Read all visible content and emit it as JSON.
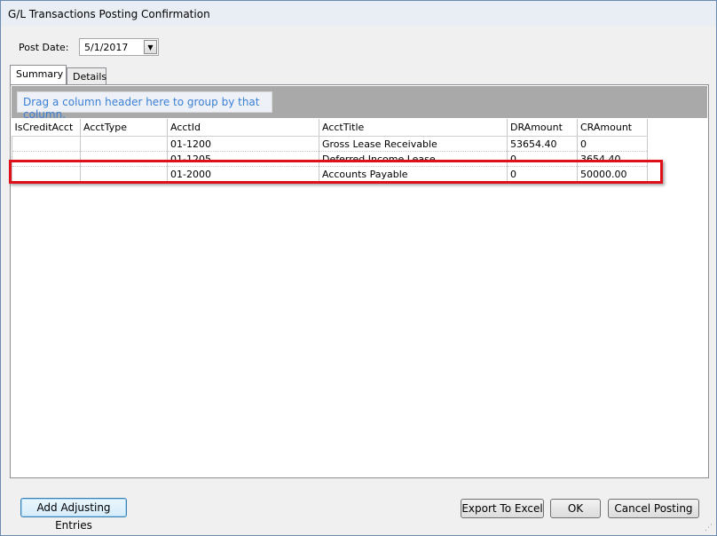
{
  "window": {
    "title": "G/L Transactions Posting Confirmation"
  },
  "post_date": {
    "label": "Post Date:",
    "value": "5/1/2017"
  },
  "tabs": [
    {
      "label": "Summary",
      "active": true
    },
    {
      "label": "Details",
      "active": false
    }
  ],
  "grid": {
    "group_hint": "Drag a column header here to group by that column.",
    "columns": [
      "IsCreditAcct",
      "AcctType",
      "AcctId",
      "AcctTitle",
      "DRAmount",
      "CRAmount"
    ],
    "rows": [
      {
        "is_credit": "",
        "acct_type": "",
        "acct_id": "01-1200",
        "acct_title": "Gross Lease Receivable",
        "dr": "53654.40",
        "cr": "0"
      },
      {
        "is_credit": "",
        "acct_type": "",
        "acct_id": "01-1205",
        "acct_title": "Deferred Income Lease",
        "dr": "0",
        "cr": "3654.40"
      },
      {
        "is_credit": "",
        "acct_type": "",
        "acct_id": "01-2000",
        "acct_title": "Accounts Payable",
        "dr": "0",
        "cr": "50000.00"
      }
    ],
    "highlight_color": "#e0101b"
  },
  "buttons": {
    "add_adjusting": "Add Adjusting Entries",
    "export": "Export To Excel",
    "ok": "OK",
    "cancel": "Cancel Posting"
  }
}
